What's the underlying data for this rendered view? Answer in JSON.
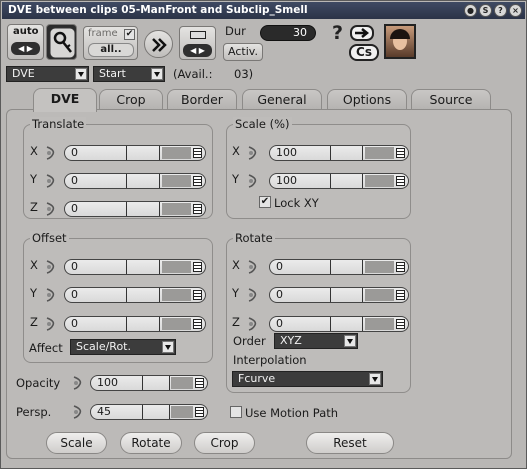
{
  "window": {
    "title": "DVE between clips 05-ManFront and Subclip_Smell"
  },
  "toolbar": {
    "auto_label": "auto",
    "frame_label": "frame",
    "all_label": "all..",
    "dur_label": "Dur",
    "dur_value": "30",
    "activ_label": "Activ.",
    "help_glyph": "?",
    "cs_label": "Cs"
  },
  "selectors": {
    "effect_value": "DVE",
    "position_value": "Start",
    "avail_label": "(Avail.:",
    "avail_value": "03)"
  },
  "tabs": [
    {
      "label": "DVE",
      "active": true
    },
    {
      "label": "Crop"
    },
    {
      "label": "Border"
    },
    {
      "label": "General"
    },
    {
      "label": "Options"
    },
    {
      "label": "Source"
    }
  ],
  "translate": {
    "title": "Translate",
    "x_label": "X",
    "x_value": "0",
    "y_label": "Y",
    "y_value": "0",
    "z_label": "Z",
    "z_value": "0"
  },
  "scale": {
    "title": "Scale (%)",
    "x_label": "X",
    "x_value": "100",
    "y_label": "Y",
    "y_value": "100",
    "lock_label": "Lock XY",
    "lock_checked": true
  },
  "offset": {
    "title": "Offset",
    "x_label": "X",
    "x_value": "0",
    "y_label": "Y",
    "y_value": "0",
    "z_label": "Z",
    "z_value": "0",
    "affect_label": "Affect",
    "affect_value": "Scale/Rot."
  },
  "rotate": {
    "title": "Rotate",
    "x_label": "X",
    "x_value": "0",
    "y_label": "Y",
    "y_value": "0",
    "z_label": "Z",
    "z_value": "0",
    "order_label": "Order",
    "order_value": "XYZ",
    "interp_label": "Interpolation",
    "interp_value": "Fcurve"
  },
  "opacity": {
    "label": "Opacity",
    "value": "100"
  },
  "persp": {
    "label": "Persp.",
    "value": "45"
  },
  "motion_path": {
    "label": "Use Motion Path",
    "checked": false
  },
  "bottom_buttons": {
    "scale": "Scale",
    "rotate": "Rotate",
    "crop": "Crop",
    "reset": "Reset"
  },
  "colors": {
    "window_bg": "#b9b7b5",
    "titlebar": "#2f384f",
    "dropdown_bg": "#3c3c3c",
    "field_shade": "#9b9a98"
  },
  "icons": [
    "key-icon",
    "forward-chevrons-icon",
    "nudge-arrows-icon",
    "help-icon",
    "arrow-icon",
    "clip-thumbnail"
  ]
}
